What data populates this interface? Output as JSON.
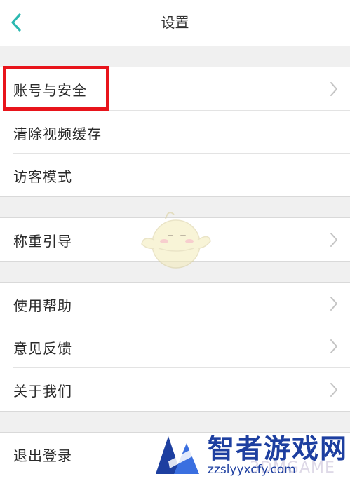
{
  "header": {
    "title": "设置",
    "back_icon": "chevron-left-icon",
    "accent": "#2bb8b0"
  },
  "groups": [
    {
      "items": [
        {
          "label": "账号与安全",
          "has_chevron": true,
          "highlighted": true
        },
        {
          "label": "清除视频缓存",
          "has_chevron": false
        },
        {
          "label": "访客模式",
          "has_chevron": false
        }
      ]
    },
    {
      "items": [
        {
          "label": "称重引导",
          "has_chevron": true
        }
      ]
    },
    {
      "items": [
        {
          "label": "使用帮助",
          "has_chevron": true
        },
        {
          "label": "意见反馈",
          "has_chevron": true
        },
        {
          "label": "关于我们",
          "has_chevron": true
        }
      ]
    },
    {
      "items": [
        {
          "label": "退出登录",
          "has_chevron": false
        }
      ]
    }
  ],
  "annotation": {
    "highlight_color": "#e8141b"
  },
  "watermark": {
    "brand": "智者游戏网",
    "url": "zzslyyxcfy.com",
    "faint_text": "3DMGAME"
  }
}
